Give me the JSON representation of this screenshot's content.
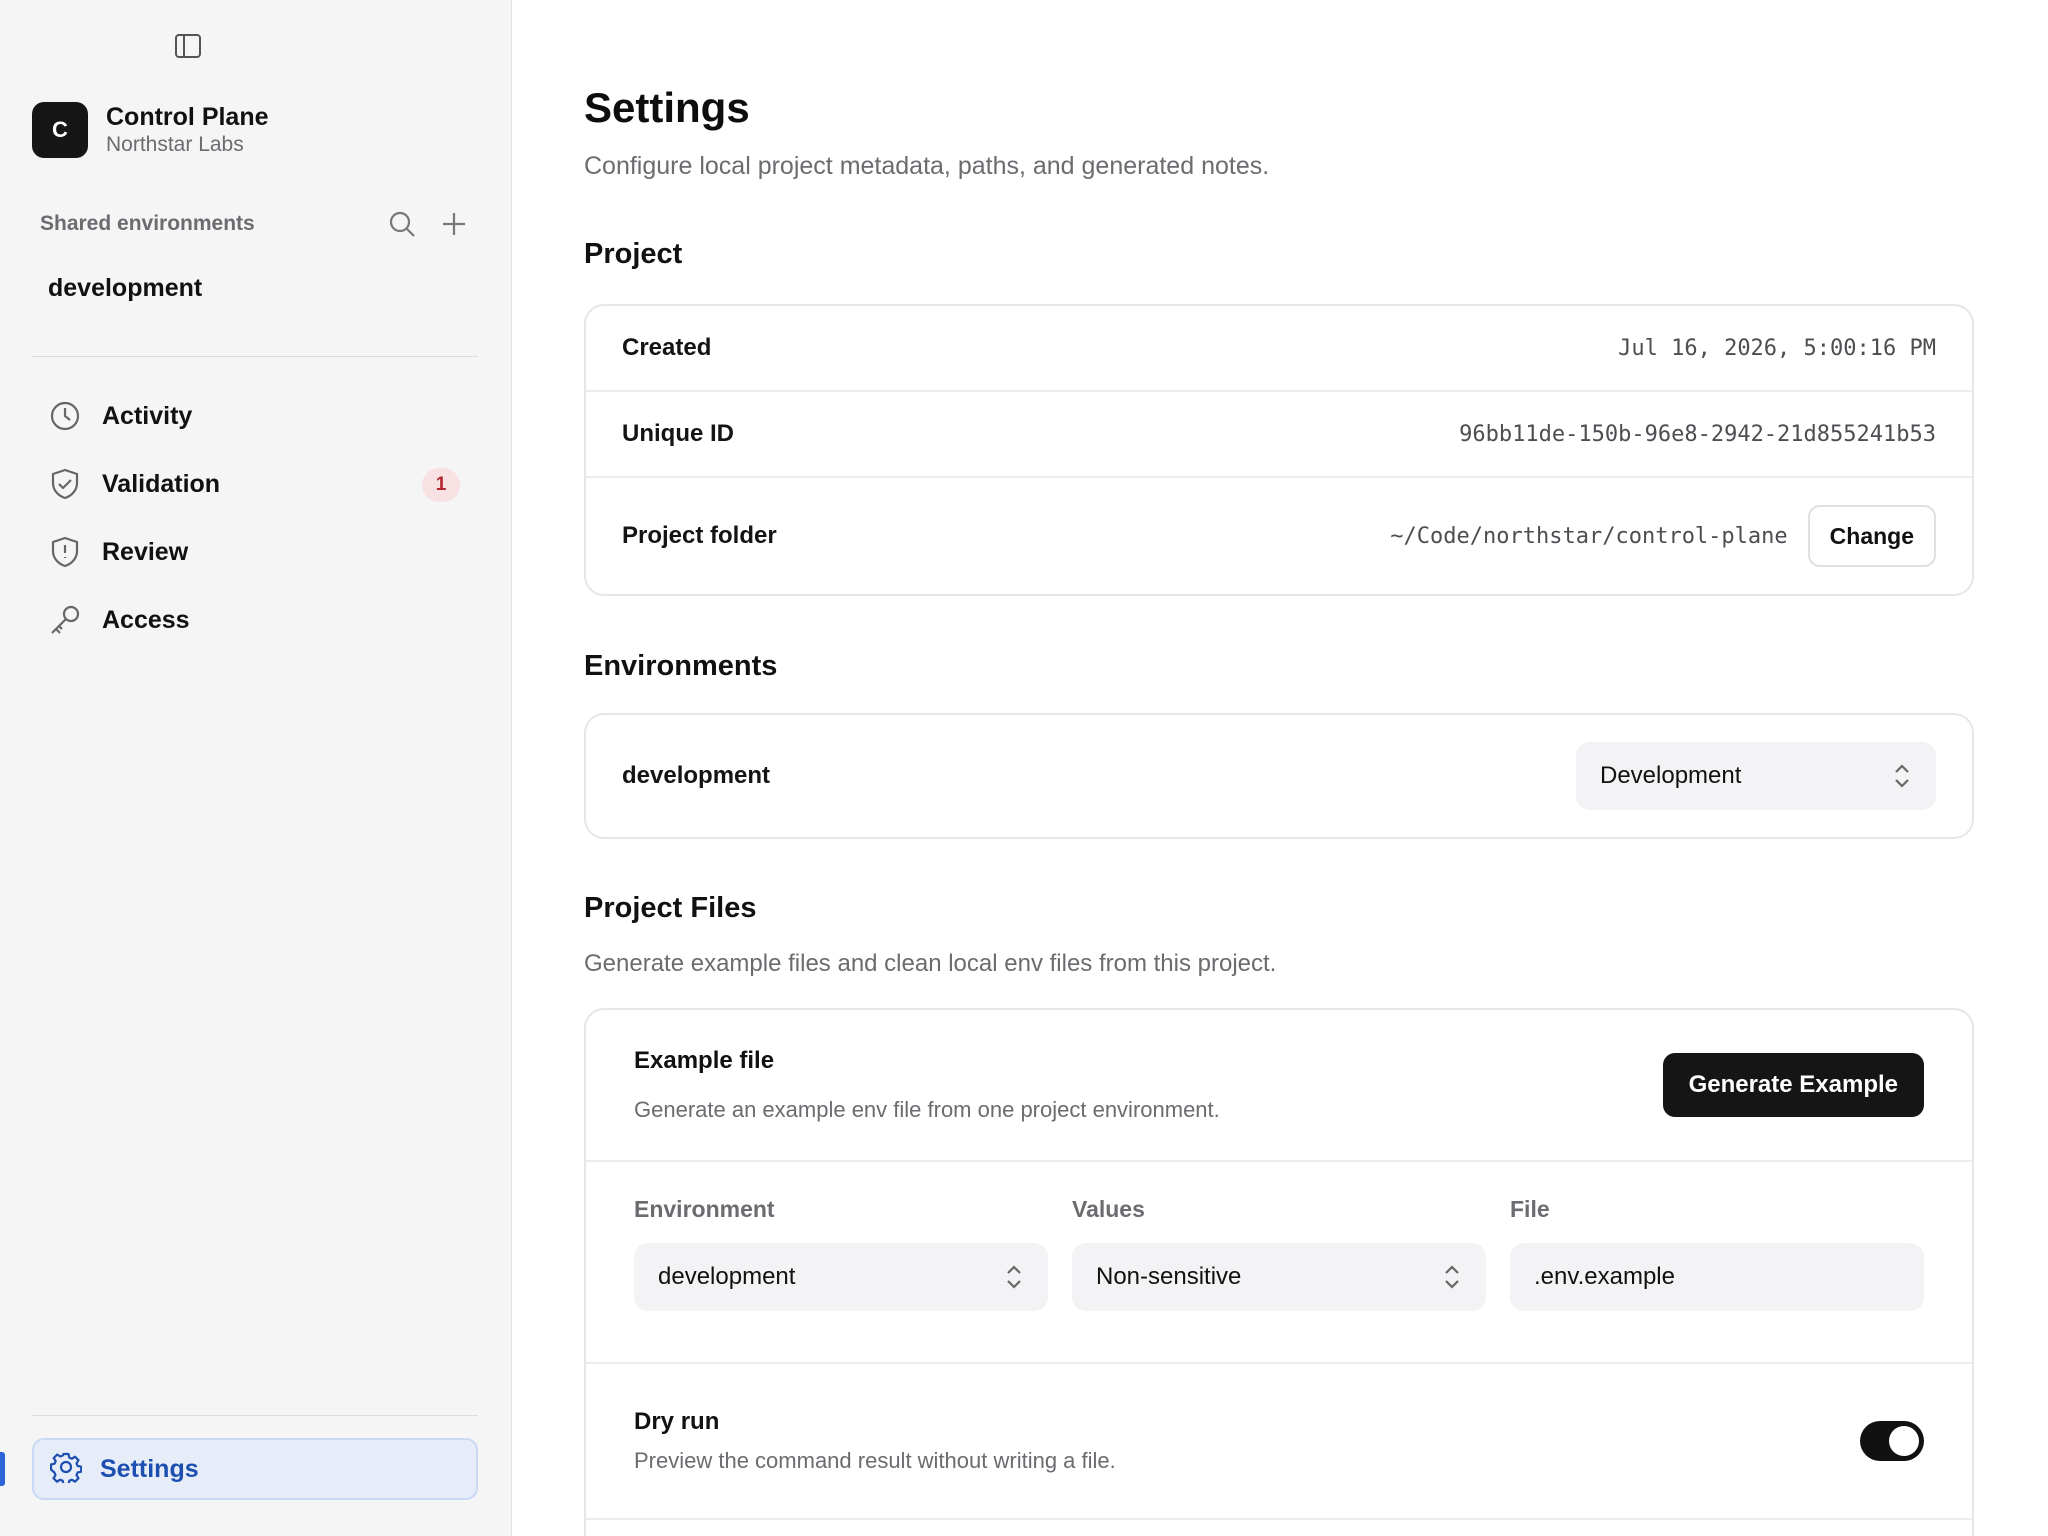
{
  "sidebar": {
    "org": {
      "initial": "C",
      "name": "Control Plane",
      "subtitle": "Northstar Labs"
    },
    "shared_label": "Shared environments",
    "environment": "development",
    "nav": [
      {
        "label": "Activity",
        "icon": "clock-icon"
      },
      {
        "label": "Validation",
        "icon": "shield-check-icon",
        "badge": "1"
      },
      {
        "label": "Review",
        "icon": "shield-alert-icon"
      },
      {
        "label": "Access",
        "icon": "key-icon"
      }
    ],
    "settings_label": "Settings",
    "accent": "#2a64d6"
  },
  "page": {
    "title": "Settings",
    "subtitle": "Configure local project metadata, paths, and generated notes."
  },
  "project": {
    "heading": "Project",
    "created_label": "Created",
    "created_value": "Jul 16, 2026, 5:00:16 PM",
    "id_label": "Unique ID",
    "id_value": "96bb11de-150b-96e8-2942-21d855241b53",
    "folder_label": "Project folder",
    "folder_value": "~/Code/northstar/control-plane",
    "change_button": "Change"
  },
  "environments": {
    "heading": "Environments",
    "name": "development",
    "type": "Development"
  },
  "files": {
    "heading": "Project Files",
    "description": "Generate example files and clean local env files from this project.",
    "example_title": "Example file",
    "example_desc": "Generate an example env file from one project environment.",
    "generate_button": "Generate Example",
    "env_label": "Environment",
    "env_value": "development",
    "values_label": "Values",
    "values_value": "Non-sensitive",
    "file_label": "File",
    "file_value": ".env.example",
    "dry_run_title": "Dry run",
    "dry_run_desc": "Preview the command result without writing a file.",
    "dry_run_enabled": true
  }
}
